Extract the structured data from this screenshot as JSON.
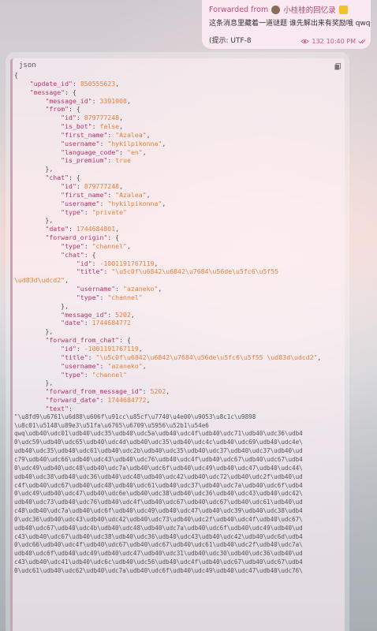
{
  "forwarded": {
    "prefix": "Forwarded from",
    "channel": "小桂桂的回忆录",
    "line1": "这条消息里藏着一道谜题 谁先解出来有奖励哦 qwq",
    "line2": "(提示: UTF-8",
    "views": "132",
    "time": "10:40 PM"
  },
  "code_block": {
    "language": "json",
    "lines": [
      [
        [
          "p",
          "{"
        ]
      ],
      [
        [
          "p",
          "    "
        ],
        [
          "k",
          "\"update_id\""
        ],
        [
          "p",
          ": "
        ],
        [
          "n",
          "850555623"
        ],
        [
          "p",
          ","
        ]
      ],
      [
        [
          "p",
          "    "
        ],
        [
          "k",
          "\"message\""
        ],
        [
          "p",
          ": {"
        ]
      ],
      [
        [
          "p",
          "        "
        ],
        [
          "k",
          "\"message_id\""
        ],
        [
          "p",
          ": "
        ],
        [
          "n",
          "3391908"
        ],
        [
          "p",
          ","
        ]
      ],
      [
        [
          "p",
          "        "
        ],
        [
          "k",
          "\"from\""
        ],
        [
          "p",
          ": {"
        ]
      ],
      [
        [
          "p",
          "            "
        ],
        [
          "k",
          "\"id\""
        ],
        [
          "p",
          ": "
        ],
        [
          "n",
          "879777248"
        ],
        [
          "p",
          ","
        ]
      ],
      [
        [
          "p",
          "            "
        ],
        [
          "k",
          "\"is_bot\""
        ],
        [
          "p",
          ": "
        ],
        [
          "b",
          "false"
        ],
        [
          "p",
          ","
        ]
      ],
      [
        [
          "p",
          "            "
        ],
        [
          "k",
          "\"first_name\""
        ],
        [
          "p",
          ": "
        ],
        [
          "s",
          "\"Azalea\""
        ],
        [
          "p",
          ","
        ]
      ],
      [
        [
          "p",
          "            "
        ],
        [
          "k",
          "\"username\""
        ],
        [
          "p",
          ": "
        ],
        [
          "s",
          "\"hykilpikonna\""
        ],
        [
          "p",
          ","
        ]
      ],
      [
        [
          "p",
          "            "
        ],
        [
          "k",
          "\"language_code\""
        ],
        [
          "p",
          ": "
        ],
        [
          "s",
          "\"en\""
        ],
        [
          "p",
          ","
        ]
      ],
      [
        [
          "p",
          "            "
        ],
        [
          "k",
          "\"is_premium\""
        ],
        [
          "p",
          ": "
        ],
        [
          "b",
          "true"
        ]
      ],
      [
        [
          "p",
          "        },"
        ]
      ],
      [
        [
          "p",
          "        "
        ],
        [
          "k",
          "\"chat\""
        ],
        [
          "p",
          ": {"
        ]
      ],
      [
        [
          "p",
          "            "
        ],
        [
          "k",
          "\"id\""
        ],
        [
          "p",
          ": "
        ],
        [
          "n",
          "879777248"
        ],
        [
          "p",
          ","
        ]
      ],
      [
        [
          "p",
          "            "
        ],
        [
          "k",
          "\"first_name\""
        ],
        [
          "p",
          ": "
        ],
        [
          "s",
          "\"Azalea\""
        ],
        [
          "p",
          ","
        ]
      ],
      [
        [
          "p",
          "            "
        ],
        [
          "k",
          "\"username\""
        ],
        [
          "p",
          ": "
        ],
        [
          "s",
          "\"hykilpikonna\""
        ],
        [
          "p",
          ","
        ]
      ],
      [
        [
          "p",
          "            "
        ],
        [
          "k",
          "\"type\""
        ],
        [
          "p",
          ": "
        ],
        [
          "s",
          "\"private\""
        ]
      ],
      [
        [
          "p",
          "        },"
        ]
      ],
      [
        [
          "p",
          "        "
        ],
        [
          "k",
          "\"date\""
        ],
        [
          "p",
          ": "
        ],
        [
          "n",
          "1744684801"
        ],
        [
          "p",
          ","
        ]
      ],
      [
        [
          "p",
          "        "
        ],
        [
          "k",
          "\"forward_origin\""
        ],
        [
          "p",
          ": {"
        ]
      ],
      [
        [
          "p",
          "            "
        ],
        [
          "k",
          "\"type\""
        ],
        [
          "p",
          ": "
        ],
        [
          "s",
          "\"channel\""
        ],
        [
          "p",
          ","
        ]
      ],
      [
        [
          "p",
          "            "
        ],
        [
          "k",
          "\"chat\""
        ],
        [
          "p",
          ": {"
        ]
      ],
      [
        [
          "p",
          "                "
        ],
        [
          "k",
          "\"id\""
        ],
        [
          "p",
          ": "
        ],
        [
          "n",
          "-1001191767119"
        ],
        [
          "p",
          ","
        ]
      ],
      [
        [
          "p",
          "                "
        ],
        [
          "k",
          "\"title\""
        ],
        [
          "p",
          ": "
        ],
        [
          "s",
          "\"\\u5c0f\\u6842\\u6842\\u7684\\u56de\\u5fc6\\u5f55"
        ]
      ],
      [
        [
          "s",
          "\\ud83d\\udcd2\""
        ],
        [
          "p",
          ","
        ]
      ],
      [
        [
          "p",
          "                "
        ],
        [
          "k",
          "\"username\""
        ],
        [
          "p",
          ": "
        ],
        [
          "s",
          "\"azaneko\""
        ],
        [
          "p",
          ","
        ]
      ],
      [
        [
          "p",
          "                "
        ],
        [
          "k",
          "\"type\""
        ],
        [
          "p",
          ": "
        ],
        [
          "s",
          "\"channel\""
        ]
      ],
      [
        [
          "p",
          "            },"
        ]
      ],
      [
        [
          "p",
          "            "
        ],
        [
          "k",
          "\"message_id\""
        ],
        [
          "p",
          ": "
        ],
        [
          "n",
          "5202"
        ],
        [
          "p",
          ","
        ]
      ],
      [
        [
          "p",
          "            "
        ],
        [
          "k",
          "\"date\""
        ],
        [
          "p",
          ": "
        ],
        [
          "n",
          "1744684772"
        ]
      ],
      [
        [
          "p",
          "        },"
        ]
      ],
      [
        [
          "p",
          "        "
        ],
        [
          "k",
          "\"forward_from_chat\""
        ],
        [
          "p",
          ": {"
        ]
      ],
      [
        [
          "p",
          "            "
        ],
        [
          "k",
          "\"id\""
        ],
        [
          "p",
          ": "
        ],
        [
          "n",
          "-1001191767119"
        ],
        [
          "p",
          ","
        ]
      ],
      [
        [
          "p",
          "            "
        ],
        [
          "k",
          "\"title\""
        ],
        [
          "p",
          ": "
        ],
        [
          "s",
          "\"\\u5c0f\\u6842\\u6842\\u7684\\u56de\\u5fc6\\u5f55 \\ud83d\\udcd2\""
        ],
        [
          "p",
          ","
        ]
      ],
      [
        [
          "p",
          "            "
        ],
        [
          "k",
          "\"username\""
        ],
        [
          "p",
          ": "
        ],
        [
          "s",
          "\"azaneko\""
        ],
        [
          "p",
          ","
        ]
      ],
      [
        [
          "p",
          "            "
        ],
        [
          "k",
          "\"type\""
        ],
        [
          "p",
          ": "
        ],
        [
          "s",
          "\"channel\""
        ]
      ],
      [
        [
          "p",
          "        },"
        ]
      ],
      [
        [
          "p",
          "        "
        ],
        [
          "k",
          "\"forward_from_message_id\""
        ],
        [
          "p",
          ": "
        ],
        [
          "n",
          "5202"
        ],
        [
          "p",
          ","
        ]
      ],
      [
        [
          "p",
          "        "
        ],
        [
          "k",
          "\"forward_date\""
        ],
        [
          "p",
          ": "
        ],
        [
          "n",
          "1744684772"
        ],
        [
          "p",
          ","
        ]
      ],
      [
        [
          "p",
          "        "
        ],
        [
          "k",
          "\"text\""
        ],
        [
          "p",
          ":"
        ]
      ]
    ],
    "text_lines": [
      "\"\\u8fd9\\u6761\\u6d88\\u606f\\u91cc\\u85cf\\u7740\\u4e00\\u9053\\u8c1c\\u9898",
      "\\u8c01\\u5148\\u89e3\\u51fa\\u6765\\u6709\\u5956\\u52b1\\u54e6",
      "qwq\\udb40\\udc01\\udb40\\udc35\\udb40\\udc5a\\udb40\\udc4f\\udb40\\udc71\\udb40\\udc36\\udb4",
      "0\\udc59\\udb40\\udc65\\udb40\\udc4d\\udb40\\udc35\\udb40\\udc4c\\udb40\\udc69\\udb40\\udc4e\\",
      "udb40\\udc35\\udb40\\udc61\\udb40\\udc2b\\udb40\\udc35\\udb40\\udc37\\udb40\\udc37\\udb40\\ud",
      "c79\\udb40\\udc66\\udb40\\udc43\\udb40\\udc76\\udb40\\udc4f\\udb40\\udc67\\udb40\\udc67\\udb4",
      "0\\udc49\\udb40\\udc48\\udb40\\udc7a\\udb40\\udc6f\\udb40\\udc49\\udb40\\udc47\\udb40\\udc44\\",
      "udb40\\udc38\\udb40\\udc36\\udb40\\udc48\\udb40\\udc42\\udb40\\udc72\\udb40\\udc2f\\udb40\\ud",
      "c4f\\udb40\\udc67\\udb40\\udc48\\udb40\\udc61\\udb40\\udc37\\udb40\\udc7a\\udb40\\udc6f\\udb4",
      "0\\udc49\\udb40\\udc47\\udb40\\udc6e\\udb40\\udc38\\udb40\\udc36\\udb40\\udc43\\udb40\\udc42\\",
      "udb40\\udc73\\udb40\\udc76\\udb40\\udc4f\\udb40\\udc67\\udb40\\udc67\\udb40\\udc61\\udb40\\ud",
      "c48\\udb40\\udc7a\\udb40\\udc6f\\udb40\\udc49\\udb40\\udc47\\udb40\\udc39\\udb40\\udc38\\udb4",
      "0\\udc36\\udb40\\udc43\\udb40\\udc42\\udb40\\udc73\\udb40\\udc2f\\udb40\\udc4f\\udb40\\udc67\\",
      "udb40\\udc67\\udb40\\udc4b\\udb40\\udc48\\udb40\\udc7a\\udb40\\udc6f\\udb40\\udc49\\udb40\\ud",
      "c43\\udb40\\udc67\\udb40\\udc38\\udb40\\udc36\\udb40\\udc43\\udb40\\udc42\\udb40\\udc6d\\udb4",
      "0\\udc66\\udb40\\udc4f\\udb40\\udc67\\udb40\\udc67\\udb40\\udc61\\udb40\\udc2f\\udb40\\udc7a\\",
      "udb40\\udc6f\\udb40\\udc49\\udb40\\udc47\\udb40\\udc31\\udb40\\udc30\\udb40\\udc36\\udb40\\ud",
      "c43\\udb40\\udc41\\udb40\\udc6c\\udb40\\udc56\\udb40\\udc4f\\udb40\\udc67\\udb40\\udc67\\udb4",
      "0\\udc61\\udb40\\udc62\\udb40\\udc7a\\udb40\\udc6f\\udb40\\udc49\\udb40\\udc47\\udb40\\udc76\\"
    ]
  }
}
